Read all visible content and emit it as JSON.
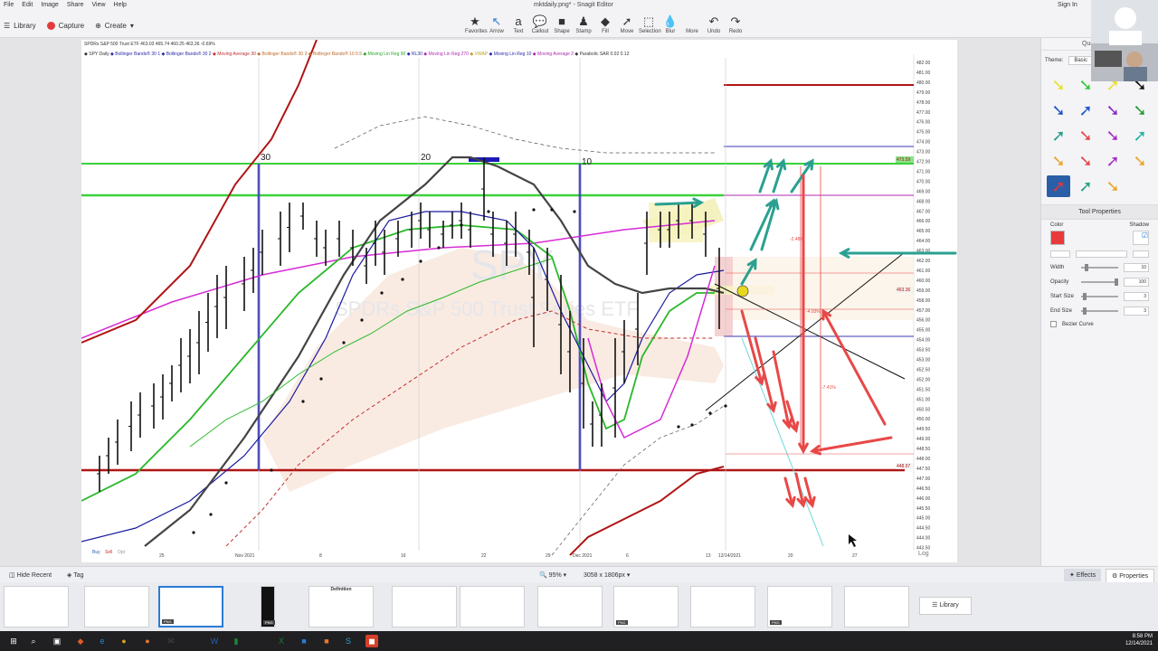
{
  "menu": [
    "File",
    "Edit",
    "Image",
    "Share",
    "View",
    "Help"
  ],
  "doc_title": "mktdaily.png* - Snagit Editor",
  "signin": "Sign In",
  "left_buttons": {
    "library": "Library",
    "capture": "Capture",
    "create": "Create"
  },
  "tools": [
    {
      "label": "Favorites",
      "icon": "star-icon"
    },
    {
      "label": "Arrow",
      "icon": "arrow-icon"
    },
    {
      "label": "Text",
      "icon": "text-icon"
    },
    {
      "label": "Callout",
      "icon": "callout-icon"
    },
    {
      "label": "Shape",
      "icon": "shape-icon"
    },
    {
      "label": "Stamp",
      "icon": "stamp-icon"
    },
    {
      "label": "Fill",
      "icon": "fill-icon"
    },
    {
      "label": "Move",
      "icon": "move-icon"
    },
    {
      "label": "Selection",
      "icon": "selection-icon"
    },
    {
      "label": "Blur",
      "icon": "blur-icon"
    },
    {
      "label": "More",
      "icon": "more-icon"
    },
    {
      "label": "Undo",
      "icon": "undo-icon"
    },
    {
      "label": "Redo",
      "icon": "redo-icon"
    }
  ],
  "chart": {
    "legend": "SPDRs S&P 500 Trust ETF  463.03  465.74  460.25  463.36  -0.69%",
    "indicators": [
      "SPY Daily",
      "Bollinger Bands® 30 1",
      "Bollinger Bands® 30 2",
      "Moving Average 30",
      "Bollinger Bands® 30 3",
      "Bollinger Bands® 10 0.5",
      "Moving Lin Reg 90",
      "RL30",
      "Moving Lin Reg 270",
      "VWAP",
      "Moving Lin Reg 10",
      "Moving Average 3",
      "Parabolic SAR 0.02 0.12"
    ],
    "watermark1": "SPY",
    "watermark2": "SPDRs S&P 500 Trust Series ETF",
    "cycle_labels": [
      "30",
      "20",
      "10"
    ],
    "pct_labels": [
      "-2.48%",
      "-4.93%",
      "-7.41%"
    ],
    "price_ticks": [
      "482.00",
      "481.00",
      "480.00",
      "479.00",
      "478.00",
      "477.00",
      "476.00",
      "475.00",
      "474.00",
      "473.00",
      "472.00",
      "471.00",
      "470.00",
      "469.00",
      "468.00",
      "467.00",
      "466.00",
      "465.00",
      "464.00",
      "463.00",
      "462.00",
      "461.00",
      "460.00",
      "459.00",
      "458.00",
      "457.00",
      "456.00",
      "455.00",
      "454.00",
      "453.50",
      "453.00",
      "452.50",
      "452.00",
      "451.50",
      "451.00",
      "450.50",
      "450.00",
      "449.50",
      "449.00",
      "448.50",
      "448.00",
      "447.50",
      "447.00",
      "446.50",
      "446.00",
      "445.50",
      "445.00",
      "444.50",
      "444.00",
      "443.50"
    ],
    "x_ticks": [
      "25",
      "Nov 2021",
      "8",
      "16",
      "22",
      "29",
      "Dec 2021",
      "6",
      "13",
      "12/14/2021",
      "20",
      "27"
    ],
    "tags": {
      "t1": "473.59",
      "t2": "463.36",
      "t3": "448.97"
    },
    "bottom_left": [
      "Buy",
      "Sell",
      "Opt"
    ],
    "log_label": "Log"
  },
  "panel": {
    "header": "Quick Styles",
    "theme_label": "Theme:",
    "theme_value": "Basic",
    "arrow_colors": [
      "#e8e22a",
      "#35c93a",
      "#e8e22a",
      "#111111",
      "#2054c8",
      "#2054c8",
      "#8a2bc6",
      "#2a9a3a",
      "#22a08a",
      "#e34848",
      "#a62bc6",
      "#22b3a3",
      "#e8a62a",
      "#e34848",
      "#a62bc6",
      "#e8a62a",
      "#e34848",
      "#22a08a",
      "#e8a62a"
    ],
    "tool_properties": "Tool Properties",
    "color_label": "Color",
    "shadow_label": "Shadow",
    "color_value": "#e83a3a",
    "width_label": "Width",
    "width_value": "10",
    "opacity_label": "Opacity",
    "opacity_value": "100",
    "start_label": "Start Size",
    "start_value": "3",
    "end_label": "End Size",
    "end_value": "3",
    "bezier_label": "Bezier Curve"
  },
  "status": {
    "zoom": "95%",
    "dims": "3058 x 1806px"
  },
  "tray": {
    "hide_recent": "Hide Recent",
    "tag": "Tag",
    "effects": "Effects",
    "properties": "Properties",
    "library": "Library",
    "definition_title": "Definition"
  },
  "clock": {
    "time": "8:58 PM",
    "date": "12/14/2021"
  }
}
